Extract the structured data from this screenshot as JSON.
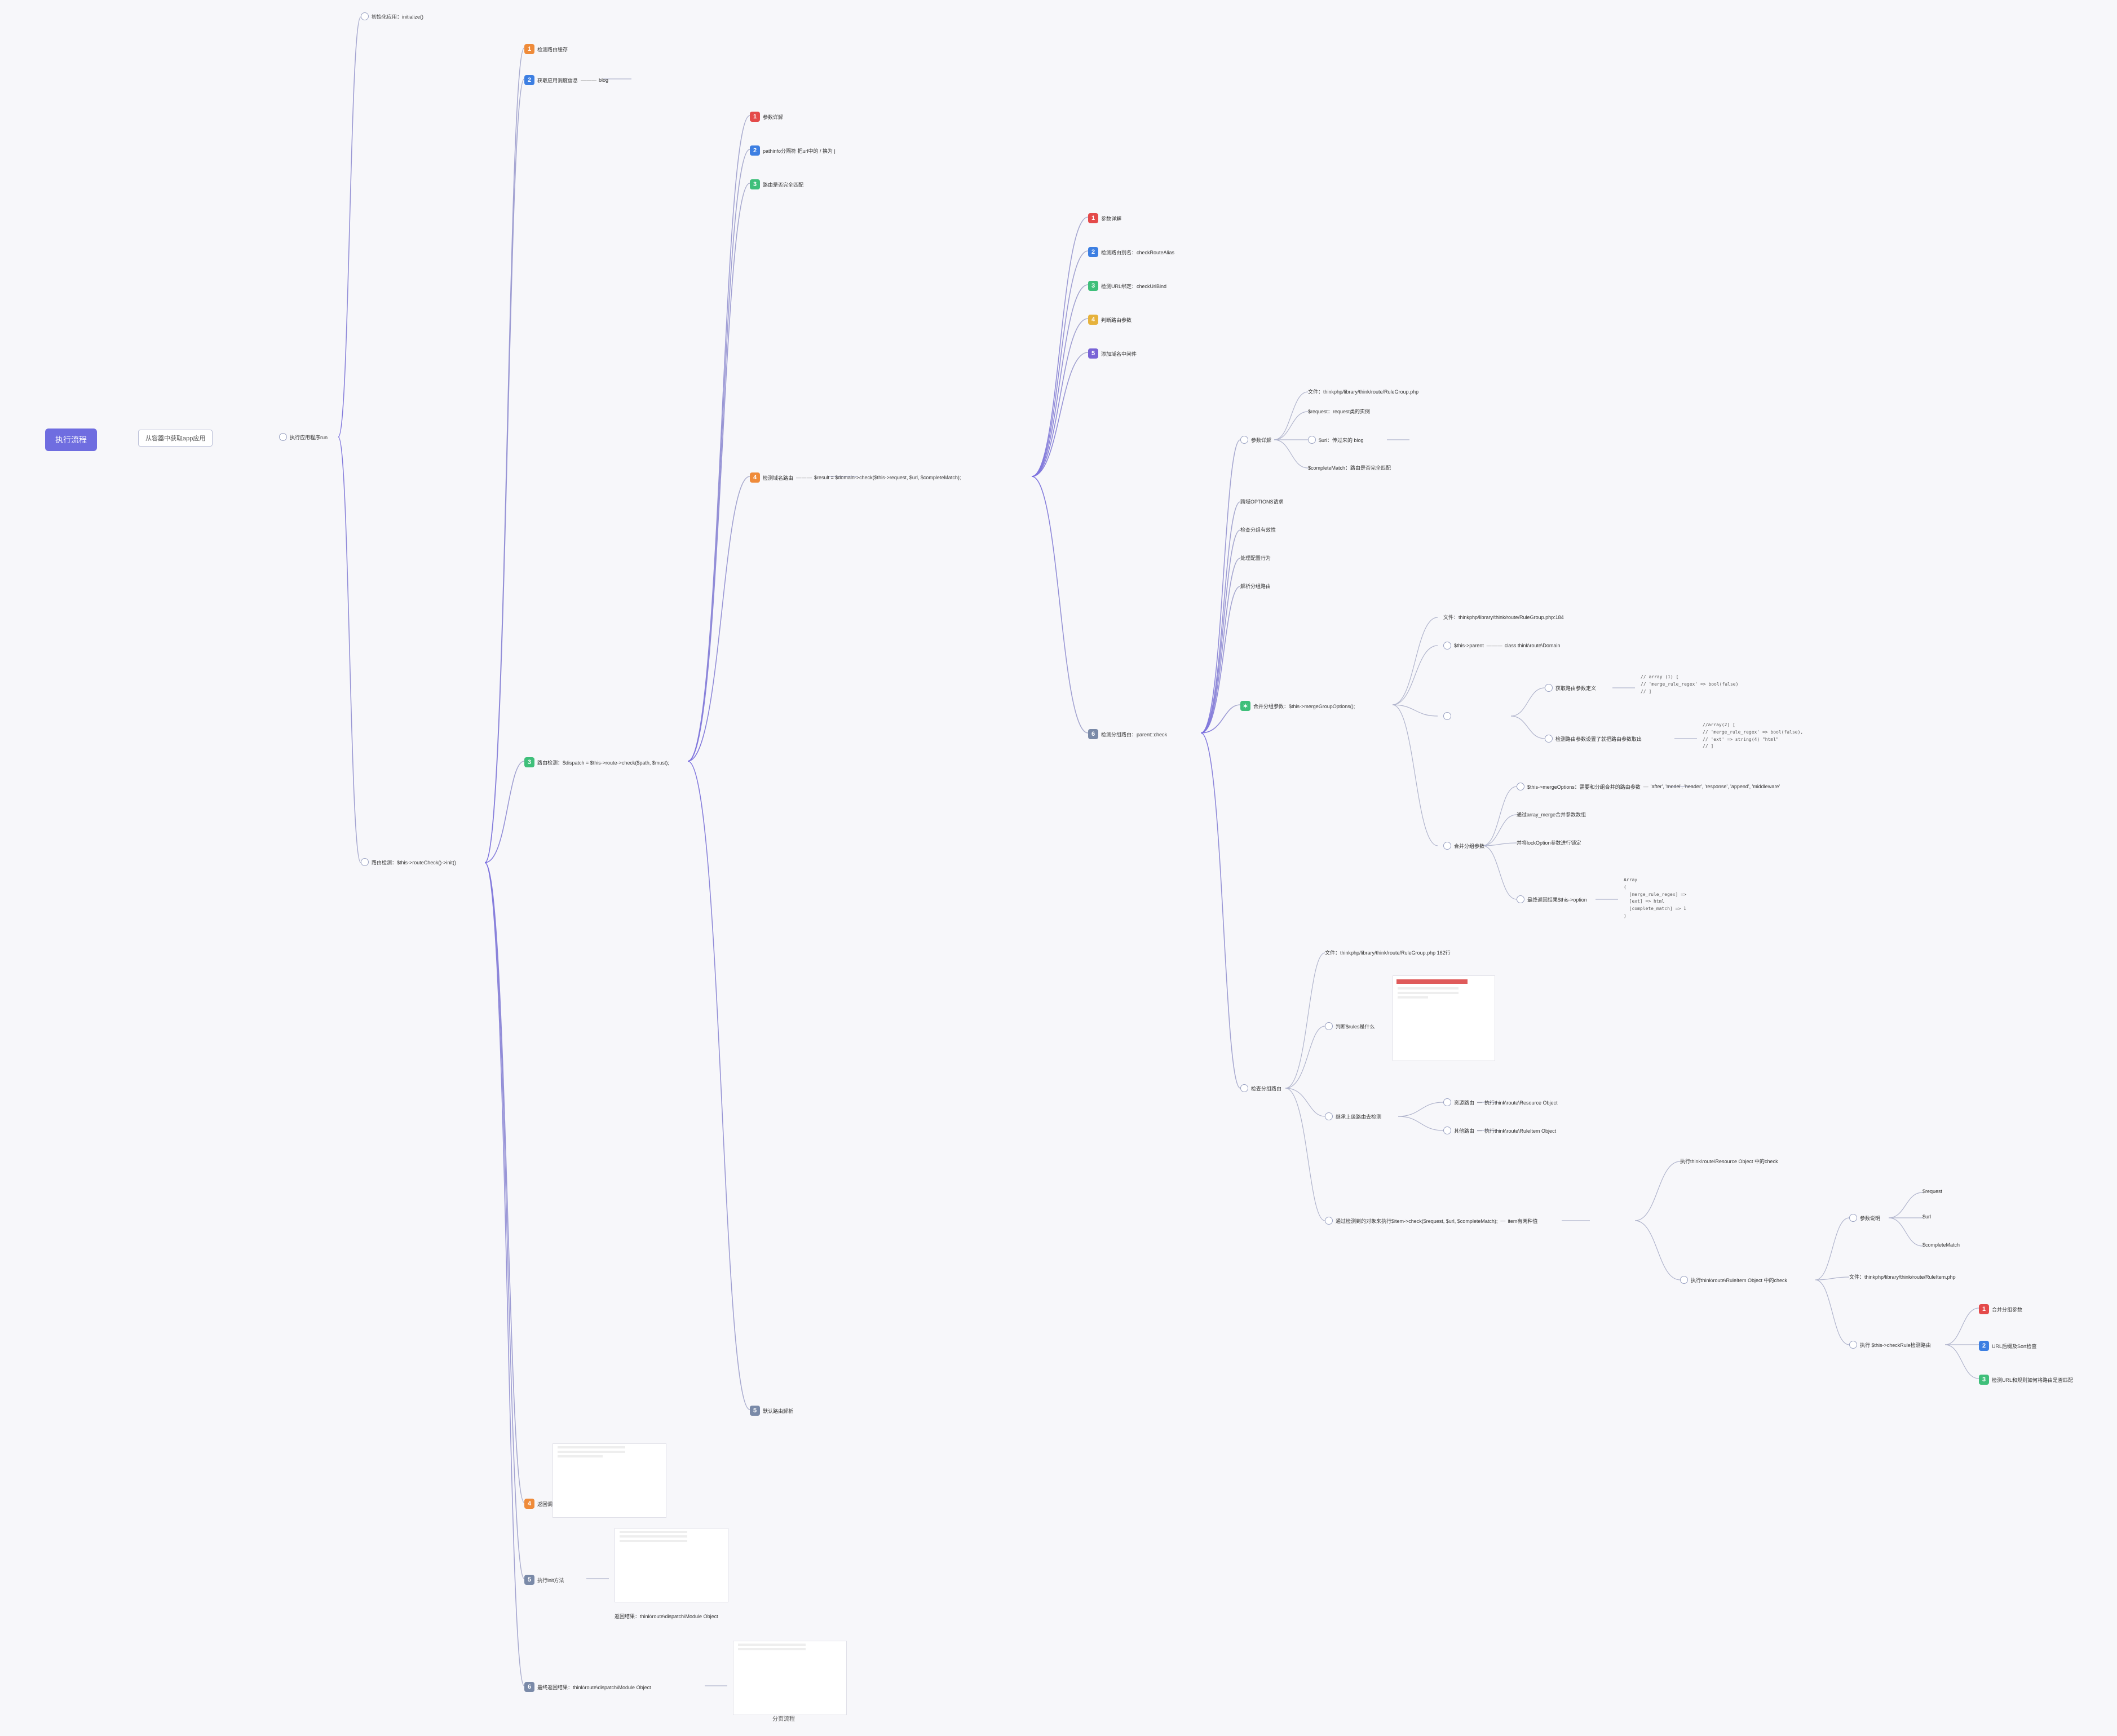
{
  "root": "执行流程",
  "trunk": {
    "t1": "从容器中获取app应用",
    "t2": "执行应用程序run"
  },
  "app": {
    "init": "初始化应用：initialize()",
    "route": "路由检测：$this->routeCheck()->init()"
  },
  "route": {
    "r1": "检测路由缓存",
    "r2_label": "获取应用调度信息",
    "r2_note": "blog",
    "r3_label": "路由检测：$dispatch = $this->route->check($path, $must);",
    "r4_label": "返回调度对象：think\\route\\dispatch\\Module Object",
    "r5_label": "执行init方法",
    "r5_note": "返回结果：think\\route\\dispatch\\Module Object",
    "r6_label": "最终返回结果：think\\route\\dispatch\\Module Object",
    "r6_caption": "分页流程"
  },
  "check": {
    "c1": "参数详解",
    "c2": "pathinfo分隔符 把url中的 / 换为 |",
    "c3": "路由是否完全匹配",
    "c4_label": "检测域名路由",
    "c4_note": "$result = $domain->check($this->request, $url, $completeMatch);",
    "c5": "默认路由解析"
  },
  "domain": {
    "d1": "参数详解",
    "d2": "检测路由别名：checkRouteAlias",
    "d3": "检测URL绑定：checkUrlBind",
    "d4": "判断路由参数",
    "d5": "添加域名中间件",
    "d6": "检测分组路由：parent::check"
  },
  "parent": {
    "p1": "参数详解",
    "p2": "跨域OPTIONS请求",
    "p3": "检查分组有效性",
    "p4": "处理配置行为",
    "p5": "解析分组路由",
    "p6_label": "合并分组参数：$this->mergeGroupOptions();",
    "p7": "检查分组路由"
  },
  "pfile": {
    "file": "文件：thinkphp/library/think/route/RuleGroup.php"
  },
  "param": {
    "req": "$request：request类的实例",
    "url_label": "$url：传过来的 blog",
    "match": "$completeMatch：路由是否完全匹配"
  },
  "merge": {
    "m_file": "文件：thinkphp/library/think/route/RuleGroup.php:184",
    "m_parent_label": "$this->parent",
    "m_parent_note": "class think\\route\\Domain",
    "m1_label": "获取路由参数定义",
    "m1_code": "// array (1) [\n// 'merge_rule_regex' => bool(false)\n// ]",
    "m2_label": "检测路由参数设置了就把路由参数取出",
    "m2_code": "//array(2) [\n// 'merge_rule_regex' => bool(false),\n// 'ext' => string(4) \"html\"\n// ]",
    "m3": "合并分组参数",
    "m3_1": "$this->mergeOptions：需要和分组合并的路由参数",
    "m3_1_note": "'after', 'model', 'header', 'response', 'append', 'middleware'",
    "m3_2": "通过array_merge合并参数数组",
    "m3_3": "并将lockOption参数进行锁定",
    "m3_4_label": "最终返回结果$this->option",
    "m3_4_code": "Array\n(\n  [merge_rule_regex] =>\n  [ext] => html\n  [complete_match] => 1\n)"
  },
  "group": {
    "g_file": "文件：thinkphp/library/think/route/RuleGroup.php 162行",
    "g1": "判断$rules是什么",
    "g2": "继承上级路由去检测",
    "g2_a_label": "资源路由",
    "g2_a_note": "执行think\\route\\Resource Object",
    "g2_b_label": "其他路由",
    "g2_b_note": "执行think\\route\\RuleItem Object",
    "g3_label": "通过检测到的对象来执行$item->check($request, $url, $completeMatch);",
    "g3_note": "item有两种值"
  },
  "item": {
    "i1": "执行think\\route\\Resource Object 中的check",
    "i2": "执行think\\route\\RuleItem Object 中的check",
    "i2_file": "文件：thinkphp/library/think/route/RuleItem.php",
    "i2_exec": "执行 $this->checkRule检测路由"
  },
  "args": {
    "title": "参数说明",
    "a1": "$request",
    "a2": "$url",
    "a3": "$completeMatch"
  },
  "checkrule": {
    "c1": "合并分组参数",
    "c2": "URL后缀及Sort检查",
    "c3": "检测URL和规则如何将路由是否匹配"
  }
}
